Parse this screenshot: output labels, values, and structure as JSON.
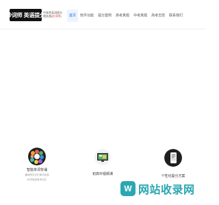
{
  "header": {
    "logo_text": "妙词师 英语提分",
    "tagline_line1": "中高考英语提分",
    "tagline_line2_prefix": "就选我(",
    "tagline_highlight": "妙词师",
    "tagline_line2_suffix": ")"
  },
  "nav": {
    "items": [
      {
        "label": "首页",
        "active": true
      },
      {
        "label": "软件功能"
      },
      {
        "label": "提分案例"
      },
      {
        "label": "高考真题"
      },
      {
        "label": "中考真题"
      },
      {
        "label": "高考志愿"
      },
      {
        "label": "联系我们"
      }
    ]
  },
  "features": [
    {
      "title": "智能单词背诵",
      "desc_line1": "趣味闯关记忆单词加强",
      "desc_line2": "科学规划单词记忆"
    },
    {
      "title": "初高中视频课",
      "desc_line1": "",
      "desc_line2": ""
    },
    {
      "title": "个性化提分方案",
      "desc_line1": "",
      "desc_line2": ""
    }
  ],
  "watermark": {
    "text": "网站收录网",
    "badge": "W"
  },
  "colors": {
    "accent": "#1e6fd9",
    "watermark": "#2aa7b2",
    "highlight": "#e53935"
  }
}
